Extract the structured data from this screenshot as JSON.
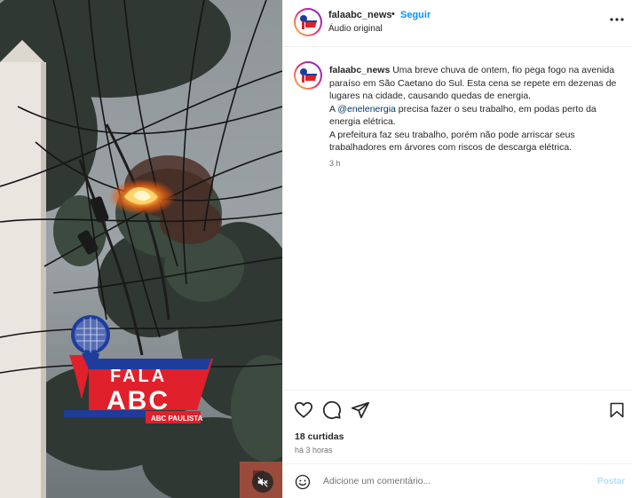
{
  "post": {
    "username": "falaabc_news",
    "separator": "•",
    "follow_label": "Seguir",
    "audio_label": "Áudio original",
    "logo_text": {
      "line1": "FALA",
      "line2": "ABC",
      "tag": "ABC PAULISTA"
    }
  },
  "caption": {
    "username": "falaabc_news",
    "line1_text": " Uma breve chuva de ontem, fio pega fogo na avenida",
    "line2": "paraíso em São Caetano do Sul. Esta cena se repete em dezenas de",
    "line3": "lugares na cidade, causando quedas de energia.",
    "line4_prefix": "A ",
    "mention": "@enelenergia",
    "line4_suffix": " precisa fazer o seu trabalho, em podas perto da",
    "line5": "energia elétrica.",
    "line6": "A prefeitura faz seu trabalho, porém não pode arriscar seus",
    "line7": "trabalhadores em árvores com riscos de descarga elétrica.",
    "time": "3 h"
  },
  "footer": {
    "likes": "18 curtidas",
    "posted": "há 3 horas",
    "comment_placeholder": "Adicione um comentário...",
    "post_label": "Postar"
  },
  "icons": {
    "more": "more-horizontal-icon",
    "like": "heart-icon",
    "comment": "comment-icon",
    "share": "send-icon",
    "save": "bookmark-icon",
    "emoji": "smiley-icon",
    "mute": "muted-speaker-icon"
  },
  "colors": {
    "accent": "#0095f6",
    "mention": "#00376b",
    "post_disabled": "#b2dffc",
    "logo_red": "#e0202a",
    "logo_blue": "#1e3c9c",
    "fire": "#ff8a1a"
  }
}
